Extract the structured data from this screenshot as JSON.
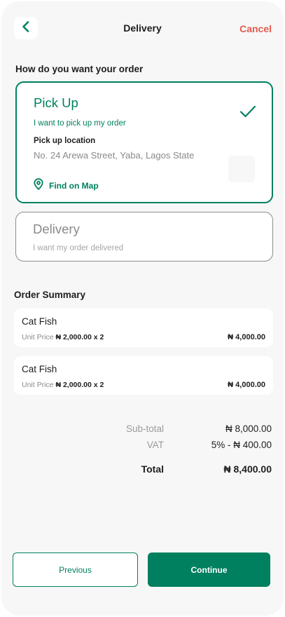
{
  "header": {
    "title": "Delivery",
    "cancel_label": "Cancel",
    "back_icon": "chevron-left-icon"
  },
  "question": "How do you want your order",
  "options": {
    "pickup": {
      "title": "Pick Up",
      "subtitle": "I want to pick up my order",
      "location_label": "Pick up location",
      "location_value": "No. 24 Arewa Street, Yaba, Lagos State",
      "find_map_label": "Find on Map",
      "selected": true
    },
    "delivery": {
      "title": "Delivery",
      "subtitle": "I want my order delivered",
      "selected": false
    }
  },
  "summary": {
    "title": "Order Summary",
    "items": [
      {
        "name": "Cat Fish",
        "unit_label": "Unit Price",
        "unit_price": "₦ 2,000.00 x 2",
        "total": "₦ 4,000.00"
      },
      {
        "name": "Cat Fish",
        "unit_label": "Unit Price",
        "unit_price": "₦ 2,000.00 x 2",
        "total": "₦ 4,000.00"
      }
    ]
  },
  "totals": {
    "subtotal_label": "Sub-total",
    "subtotal_value": "₦ 8,000.00",
    "vat_label": "VAT",
    "vat_value": "5% - ₦ 400.00",
    "total_label": "Total",
    "total_value": "₦ 8,400.00"
  },
  "buttons": {
    "previous": "Previous",
    "continue": "Continue"
  },
  "colors": {
    "brand": "#00805f",
    "cancel": "#e25a4f",
    "background": "#f7f7f7"
  }
}
